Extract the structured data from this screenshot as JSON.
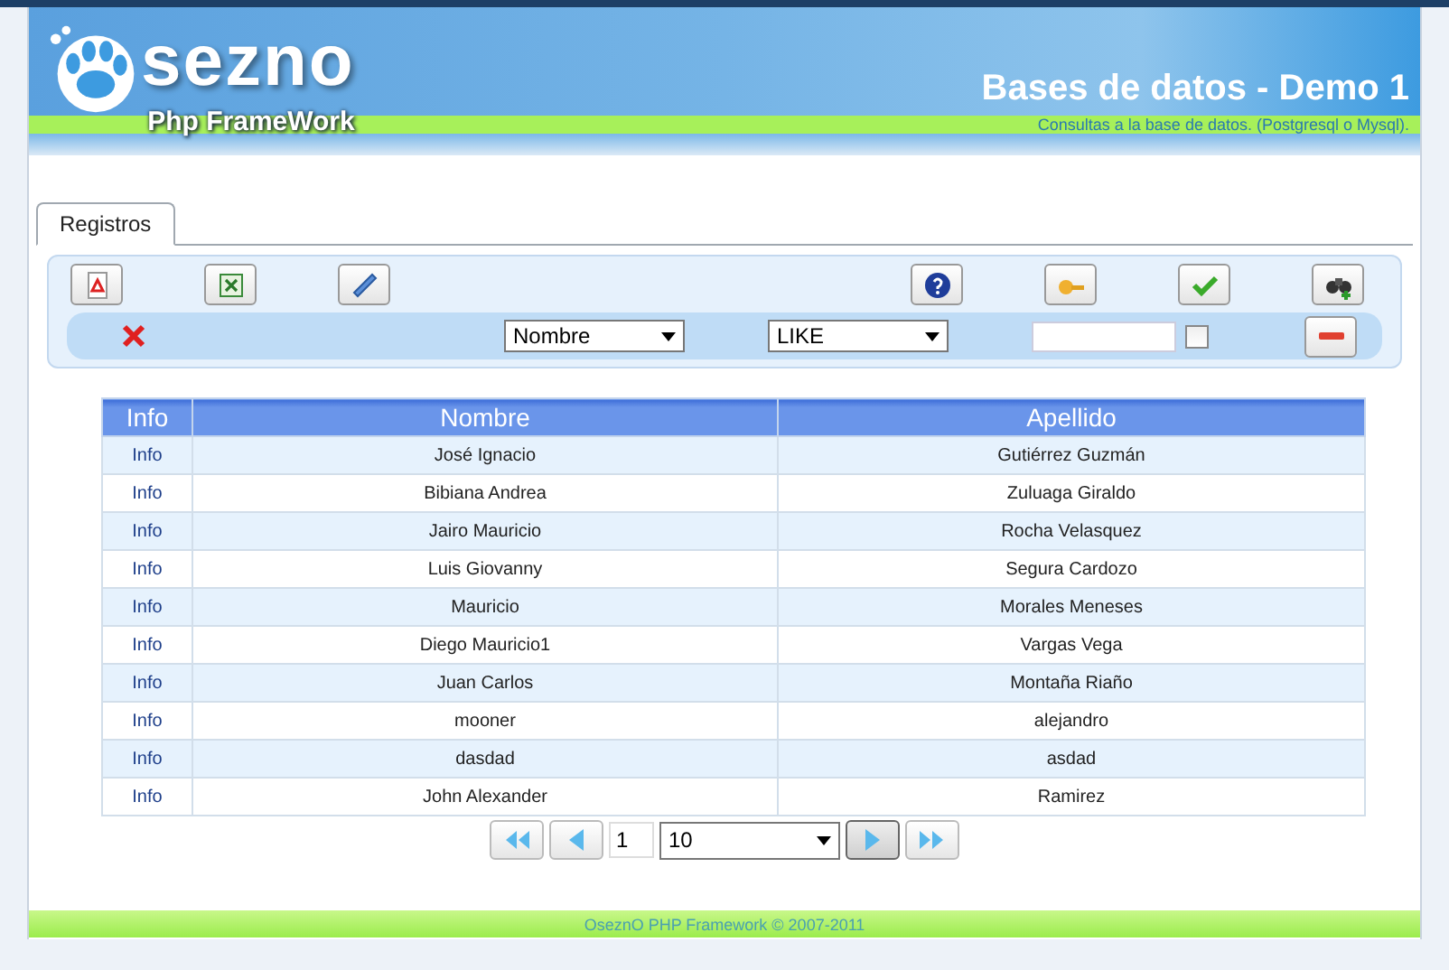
{
  "header": {
    "logo_word": "sezno",
    "logo_tagline": "Php FrameWork",
    "title": "Bases de datos - Demo 1",
    "subtitle": "Consultas a la base de datos. (Postgresql o Mysql)."
  },
  "tabs": [
    {
      "label": "Registros",
      "selected": true
    }
  ],
  "toolbar": {
    "left_buttons": [
      {
        "kind": "pdf"
      },
      {
        "kind": "excel"
      },
      {
        "kind": "ruler"
      }
    ],
    "right_buttons": [
      {
        "kind": "help"
      },
      {
        "kind": "key"
      },
      {
        "kind": "check"
      },
      {
        "kind": "binoculars"
      }
    ]
  },
  "filter": {
    "field": "Nombre",
    "operator": "LIKE",
    "checked": false
  },
  "table": {
    "columns": [
      "Info",
      "Nombre",
      "Apellido"
    ],
    "rows": [
      {
        "info": "Info",
        "nombre": "José Ignacio",
        "apellido": "Gutiérrez Guzmán"
      },
      {
        "info": "Info",
        "nombre": "Bibiana Andrea",
        "apellido": "Zuluaga Giraldo"
      },
      {
        "info": "Info",
        "nombre": "Jairo Mauricio",
        "apellido": "Rocha Velasquez"
      },
      {
        "info": "Info",
        "nombre": "Luis Giovanny",
        "apellido": "Segura Cardozo"
      },
      {
        "info": "Info",
        "nombre": "Mauricio",
        "apellido": "Morales Meneses"
      },
      {
        "info": "Info",
        "nombre": "Diego Mauricio1",
        "apellido": "Vargas Vega"
      },
      {
        "info": "Info",
        "nombre": "Juan Carlos",
        "apellido": "Montaña Riaño"
      },
      {
        "info": "Info",
        "nombre": "mooner",
        "apellido": "alejandro"
      },
      {
        "info": "Info",
        "nombre": "dasdad",
        "apellido": "asdad"
      },
      {
        "info": "Info",
        "nombre": "John Alexander",
        "apellido": "Ramirez"
      }
    ]
  },
  "pager": {
    "page": "1",
    "page_size": "10"
  },
  "footer": "OseznO PHP Framework © 2007-2011"
}
